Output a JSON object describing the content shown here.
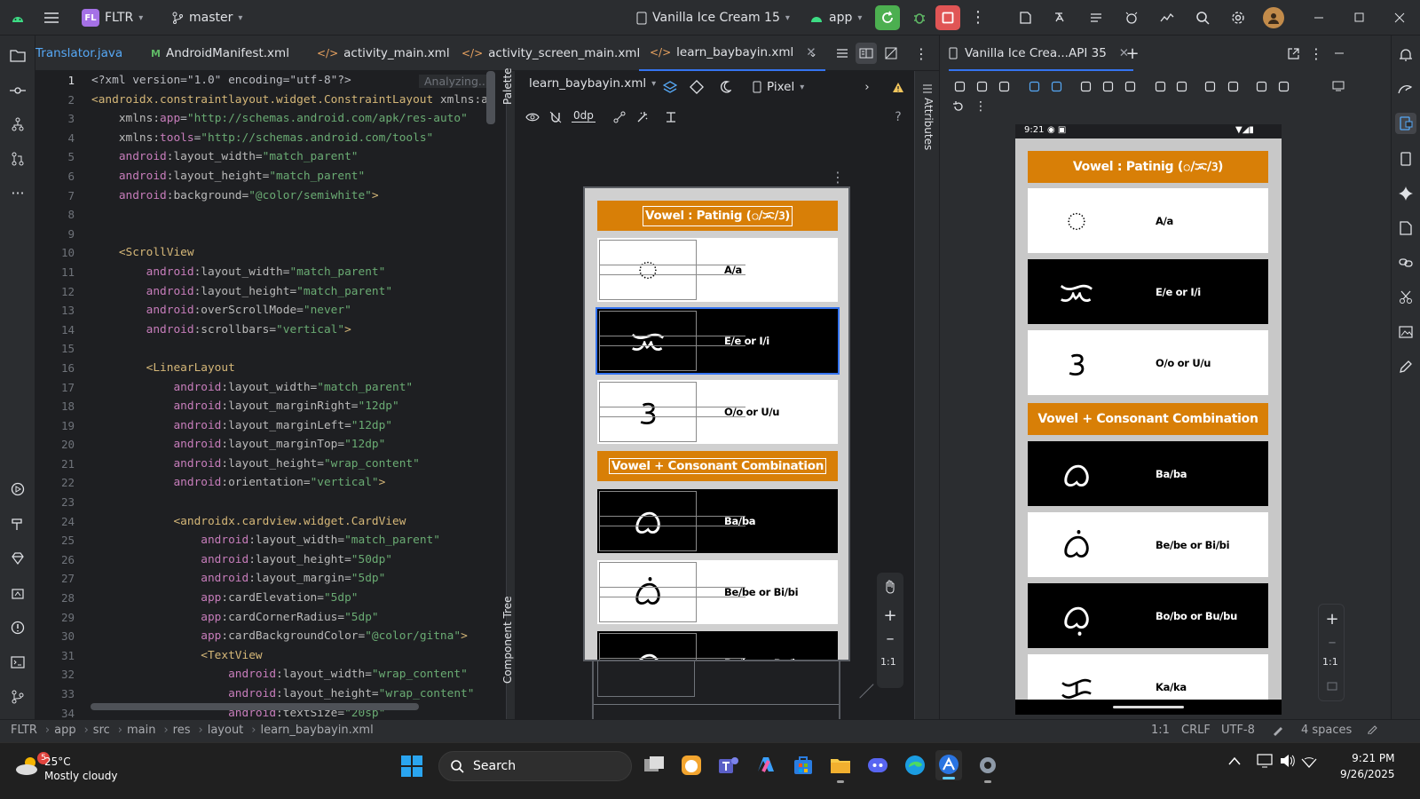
{
  "titlebar": {
    "project_badge": "FL",
    "project_name": "FLTR",
    "branch": "master",
    "device": "Vanilla Ice Cream 15",
    "run_config": "app"
  },
  "tabs": [
    {
      "label": "Translator.java"
    },
    {
      "label": "AndroidManifest.xml"
    },
    {
      "label": "activity_main.xml"
    },
    {
      "label": "activity_screen_main.xml"
    },
    {
      "label": "learn_baybayin.xml"
    }
  ],
  "editor": {
    "status": "Analyzing...",
    "line_numbers": [
      "1",
      "2",
      "3",
      "4",
      "5",
      "6",
      "7",
      "8",
      "9",
      "10",
      "11",
      "12",
      "13",
      "14",
      "15",
      "16",
      "17",
      "18",
      "19",
      "20",
      "21",
      "22",
      "23",
      "24",
      "25",
      "26",
      "27",
      "28",
      "29",
      "30",
      "31",
      "32",
      "33",
      "34"
    ],
    "lines": [
      [
        {
          "t": "<?xml version=\"1.0\" encoding=\"utf-8\"?>",
          "c": "pl"
        }
      ],
      [
        {
          "t": "<androidx.constraintlayout.widget.ConstraintLayout ",
          "c": "tg"
        },
        {
          "t": "xmlns:a",
          "c": "at"
        }
      ],
      [
        {
          "t": "    xmlns:",
          "c": "at"
        },
        {
          "t": "app",
          "c": "an"
        },
        {
          "t": "=",
          "c": "pl"
        },
        {
          "t": "\"http://schemas.android.com/apk/res-auto\"",
          "c": "vs"
        }
      ],
      [
        {
          "t": "    xmlns:",
          "c": "at"
        },
        {
          "t": "tools",
          "c": "an"
        },
        {
          "t": "=",
          "c": "pl"
        },
        {
          "t": "\"http://schemas.android.com/tools\"",
          "c": "vs"
        }
      ],
      [
        {
          "t": "    android",
          "c": "an"
        },
        {
          "t": ":layout_width=",
          "c": "at"
        },
        {
          "t": "\"match_parent\"",
          "c": "vs"
        }
      ],
      [
        {
          "t": "    android",
          "c": "an"
        },
        {
          "t": ":layout_height=",
          "c": "at"
        },
        {
          "t": "\"match_parent\"",
          "c": "vs"
        }
      ],
      [
        {
          "t": "    android",
          "c": "an"
        },
        {
          "t": ":background=",
          "c": "at"
        },
        {
          "t": "\"@color/semiwhite\"",
          "c": "vs"
        },
        {
          "t": ">",
          "c": "tg"
        }
      ],
      [
        {
          "t": "",
          "c": "pl"
        }
      ],
      [
        {
          "t": "",
          "c": "pl"
        }
      ],
      [
        {
          "t": "    <ScrollView",
          "c": "tg"
        }
      ],
      [
        {
          "t": "        android",
          "c": "an"
        },
        {
          "t": ":layout_width=",
          "c": "at"
        },
        {
          "t": "\"match_parent\"",
          "c": "vs"
        }
      ],
      [
        {
          "t": "        android",
          "c": "an"
        },
        {
          "t": ":layout_height=",
          "c": "at"
        },
        {
          "t": "\"match_parent\"",
          "c": "vs"
        }
      ],
      [
        {
          "t": "        android",
          "c": "an"
        },
        {
          "t": ":overScrollMode=",
          "c": "at"
        },
        {
          "t": "\"never\"",
          "c": "vs"
        }
      ],
      [
        {
          "t": "        android",
          "c": "an"
        },
        {
          "t": ":scrollbars=",
          "c": "at"
        },
        {
          "t": "\"vertical\"",
          "c": "vs"
        },
        {
          "t": ">",
          "c": "tg"
        }
      ],
      [
        {
          "t": "",
          "c": "pl"
        }
      ],
      [
        {
          "t": "        <LinearLayout",
          "c": "tg"
        }
      ],
      [
        {
          "t": "            android",
          "c": "an"
        },
        {
          "t": ":layout_width=",
          "c": "at"
        },
        {
          "t": "\"match_parent\"",
          "c": "vs"
        }
      ],
      [
        {
          "t": "            android",
          "c": "an"
        },
        {
          "t": ":layout_marginRight=",
          "c": "at"
        },
        {
          "t": "\"12dp\"",
          "c": "vs"
        }
      ],
      [
        {
          "t": "            android",
          "c": "an"
        },
        {
          "t": ":layout_marginLeft=",
          "c": "at"
        },
        {
          "t": "\"12dp\"",
          "c": "vs"
        }
      ],
      [
        {
          "t": "            android",
          "c": "an"
        },
        {
          "t": ":layout_marginTop=",
          "c": "at"
        },
        {
          "t": "\"12dp\"",
          "c": "vs"
        }
      ],
      [
        {
          "t": "            android",
          "c": "an"
        },
        {
          "t": ":layout_height=",
          "c": "at"
        },
        {
          "t": "\"wrap_content\"",
          "c": "vs"
        }
      ],
      [
        {
          "t": "            android",
          "c": "an"
        },
        {
          "t": ":orientation=",
          "c": "at"
        },
        {
          "t": "\"vertical\"",
          "c": "vs"
        },
        {
          "t": ">",
          "c": "tg"
        }
      ],
      [
        {
          "t": "",
          "c": "pl"
        }
      ],
      [
        {
          "t": "            <androidx.cardview.widget.CardView",
          "c": "tg"
        }
      ],
      [
        {
          "t": "                android",
          "c": "an"
        },
        {
          "t": ":layout_width=",
          "c": "at"
        },
        {
          "t": "\"match_parent\"",
          "c": "vs"
        }
      ],
      [
        {
          "t": "                android",
          "c": "an"
        },
        {
          "t": ":layout_height=",
          "c": "at"
        },
        {
          "t": "\"50dp\"",
          "c": "vs"
        }
      ],
      [
        {
          "t": "                android",
          "c": "an"
        },
        {
          "t": ":layout_margin=",
          "c": "at"
        },
        {
          "t": "\"5dp\"",
          "c": "vs"
        }
      ],
      [
        {
          "t": "                app",
          "c": "an"
        },
        {
          "t": ":cardElevation=",
          "c": "at"
        },
        {
          "t": "\"5dp\"",
          "c": "vs"
        }
      ],
      [
        {
          "t": "                app",
          "c": "an"
        },
        {
          "t": ":cardCornerRadius=",
          "c": "at"
        },
        {
          "t": "\"5dp\"",
          "c": "vs"
        }
      ],
      [
        {
          "t": "                app",
          "c": "an"
        },
        {
          "t": ":cardBackgroundColor=",
          "c": "at"
        },
        {
          "t": "\"@color/gitna\"",
          "c": "vs"
        },
        {
          "t": ">",
          "c": "tg"
        }
      ],
      [
        {
          "t": "                <TextView",
          "c": "tg"
        }
      ],
      [
        {
          "t": "                    android",
          "c": "an"
        },
        {
          "t": ":layout_width=",
          "c": "at"
        },
        {
          "t": "\"wrap_content\"",
          "c": "vs"
        }
      ],
      [
        {
          "t": "                    android",
          "c": "an"
        },
        {
          "t": ":layout_height=",
          "c": "at"
        },
        {
          "t": "\"wrap_content\"",
          "c": "vs"
        }
      ],
      [
        {
          "t": "                    android",
          "c": "an"
        },
        {
          "t": ":textSize=",
          "c": "at"
        },
        {
          "t": "\"20sp\"",
          "c": "vs"
        }
      ]
    ]
  },
  "side_labels": {
    "palette": "Palette",
    "component_tree": "Component Tree",
    "attributes": "Attributes"
  },
  "designer": {
    "file": "learn_baybayin.xml",
    "device": "Pixel",
    "margin": "0dp",
    "zoom_reset": "1:1"
  },
  "baybayin": {
    "header1": "Vowel : Patinig (ᜀ/ᜁ/ᜂ)",
    "header2": "Vowel + Consonant Combination",
    "vowels": [
      {
        "glyph": "ᜀ",
        "label": "A/a",
        "dark": false
      },
      {
        "glyph": "ᜁ",
        "label": "E/e or I/i",
        "dark": true
      },
      {
        "glyph": "ᜂ",
        "label": "O/o or U/u",
        "dark": false
      }
    ],
    "combos": [
      {
        "glyph": "ᜊ",
        "label": "Ba/ba",
        "dark": true
      },
      {
        "glyph": "ᜊᜒ",
        "label": "Be/be or Bi/bi",
        "dark": false
      },
      {
        "glyph": "ᜊᜓ",
        "label": "Bo/bo or Bu/bu",
        "dark": true
      },
      {
        "glyph": "ᜃ",
        "label": "Ka/ka",
        "dark": false
      }
    ]
  },
  "running": {
    "tab_label": "Vanilla Ice Crea...API 35",
    "phone_time": "9:21",
    "zoom_reset": "1:1"
  },
  "statusbar": {
    "breadcrumb": [
      "FLTR",
      "app",
      "src",
      "main",
      "res",
      "layout",
      "learn_baybayin.xml"
    ],
    "position": "1:1",
    "line_sep": "CRLF",
    "encoding": "UTF-8",
    "indent": "4 spaces"
  },
  "taskbar": {
    "weather_temp": "25°C",
    "weather_desc": "Mostly cloudy",
    "weather_badge": "5",
    "search_placeholder": "Search",
    "time": "9:21 PM",
    "date": "9/26/2025"
  },
  "colors": {
    "accent": "#3574f0",
    "orange_header": "#d87f07",
    "run_green": "#4caf50",
    "stop_red": "#e05555"
  }
}
